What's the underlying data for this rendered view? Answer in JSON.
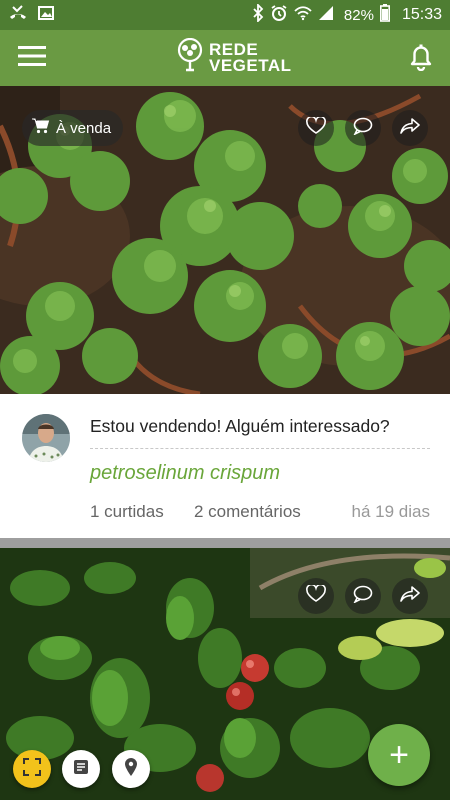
{
  "status_bar": {
    "battery": "82%",
    "time": "15:33"
  },
  "app_bar": {
    "logo_line1": "REDE",
    "logo_line2": "VEGETAL"
  },
  "posts": [
    {
      "sale_label": "À venda",
      "title": "Estou vendendo! Alguém interessado?",
      "species": "petroselinum crispum",
      "likes": "1 curtidas",
      "comments": "2 comentários",
      "time_ago": "há 19 dias"
    }
  ],
  "fab": {
    "label": "+"
  },
  "icons": [
    "phone-missed-icon",
    "image-icon",
    "bluetooth-icon",
    "alarm-icon",
    "wifi-icon",
    "signal-icon",
    "battery-icon",
    "menu-icon",
    "tree-logo-icon",
    "bell-icon",
    "cart-icon",
    "heart-icon",
    "comment-icon",
    "share-icon",
    "scan-icon",
    "list-icon",
    "location-pin-icon",
    "plus-icon"
  ]
}
